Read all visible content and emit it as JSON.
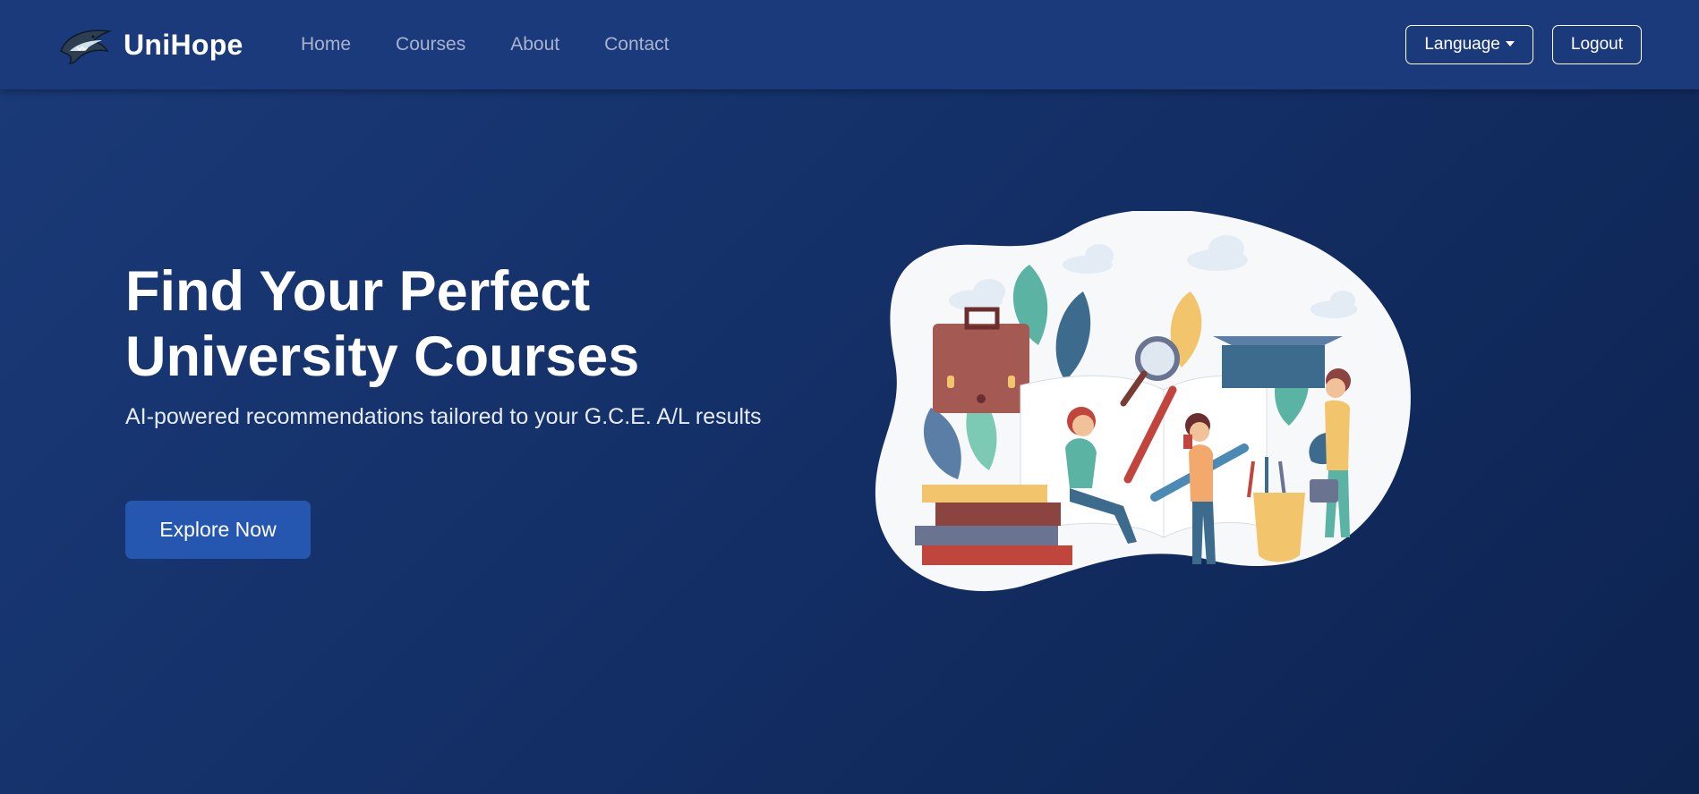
{
  "brand": {
    "name": "UniHope",
    "logo_icon": "shark-logo-icon"
  },
  "nav": {
    "links": [
      "Home",
      "Courses",
      "About",
      "Contact"
    ]
  },
  "actions": {
    "language_label": "Language",
    "logout_label": "Logout"
  },
  "hero": {
    "title_line1": "Find Your Perfect",
    "title_line2": "University Courses",
    "subtitle": "AI-powered recommendations tailored to your G.C.E. A/L results",
    "cta_label": "Explore Now"
  },
  "colors": {
    "navbar": "#1b3a7c",
    "background": "#143068",
    "accent_button": "#2657b0",
    "nav_link": "#a8b4cc"
  }
}
